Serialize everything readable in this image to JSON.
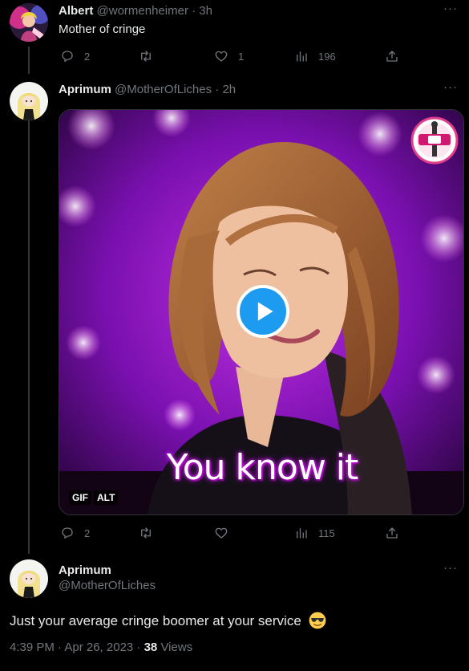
{
  "tweets": [
    {
      "name": "Albert",
      "handle": "@wormenheimer",
      "separator": "·",
      "time": "3h",
      "text": "Mother of cringe",
      "replies": "2",
      "retweets": "",
      "likes": "1",
      "views": "196",
      "avatar_icon": "avatar-albert"
    },
    {
      "name": "Aprimum",
      "handle": "@MotherOfLiches",
      "separator": "·",
      "time": "2h",
      "media": {
        "caption": "You know it",
        "badge_gif": "GIF",
        "badge_alt": "ALT",
        "logo_icon": "show-logo-icon",
        "play_icon": "play-icon"
      },
      "replies": "2",
      "retweets": "",
      "likes": "",
      "views": "115",
      "avatar_icon": "avatar-aprimum"
    }
  ],
  "focus": {
    "name": "Aprimum",
    "handle": "@MotherOfLiches",
    "text": "Just your average cringe boomer at your service",
    "emoji_icon": "sunglasses-emoji",
    "timestamp": "4:39 PM · Apr 26, 2023 · ",
    "views_count": "38",
    "views_label": " Views"
  },
  "colors": {
    "background": "#000000",
    "text": "#e7e9ea",
    "secondary": "#71767b",
    "accent": "#1d9bf0",
    "thread_line": "#333639"
  }
}
